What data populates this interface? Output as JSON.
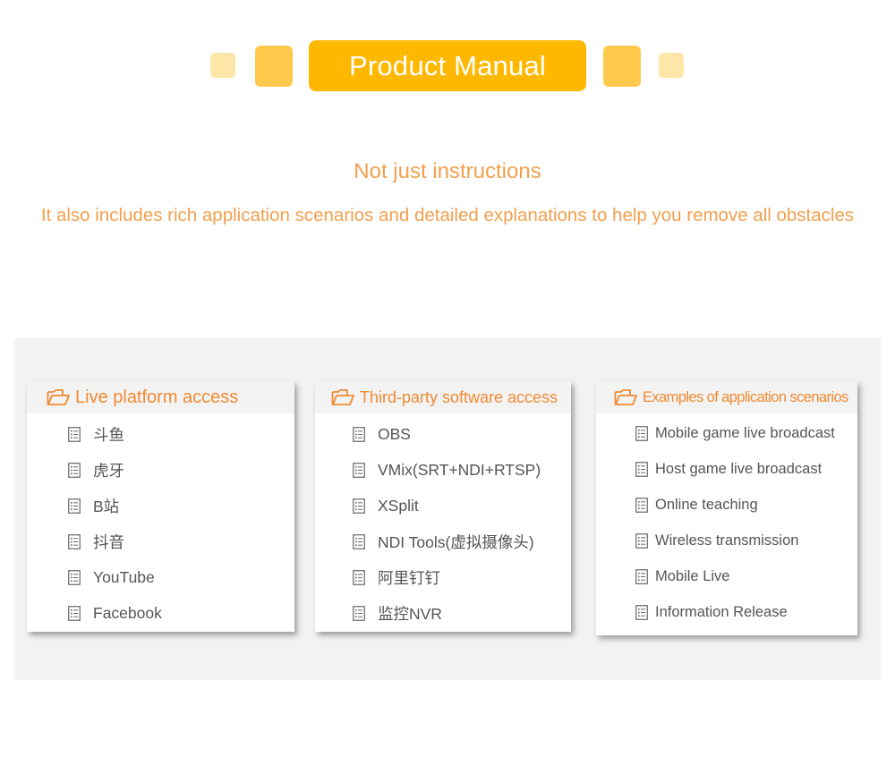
{
  "banner": {
    "title": "Product Manual"
  },
  "intro": {
    "line1": "Not just instructions",
    "line2": "It also includes rich application scenarios and detailed explanations to help you remove all obstacles"
  },
  "colors": {
    "banner": "#ffb800",
    "accent_text": "#f2a04e",
    "card_heading": "#f08a32",
    "item_text": "#555555",
    "panel_bg": "#f2f2f2"
  },
  "icons": {
    "heading": "folder-open-icon",
    "item": "document-list-icon"
  },
  "cards": [
    {
      "heading": "Live platform access",
      "items": [
        "斗鱼",
        "虎牙",
        "B站",
        "抖音",
        "YouTube",
        "Facebook"
      ]
    },
    {
      "heading": "Third-party software access",
      "items": [
        "OBS",
        "VMix(SRT+NDI+RTSP)",
        "XSplit",
        "NDI Tools(虚拟摄像头)",
        "阿里钉钉",
        "监控NVR"
      ]
    },
    {
      "heading": "Examples of application scenarios",
      "items": [
        "Mobile game live broadcast",
        "Host game live broadcast",
        "Online teaching",
        "Wireless transmission",
        "Mobile Live",
        "Information Release"
      ]
    }
  ]
}
